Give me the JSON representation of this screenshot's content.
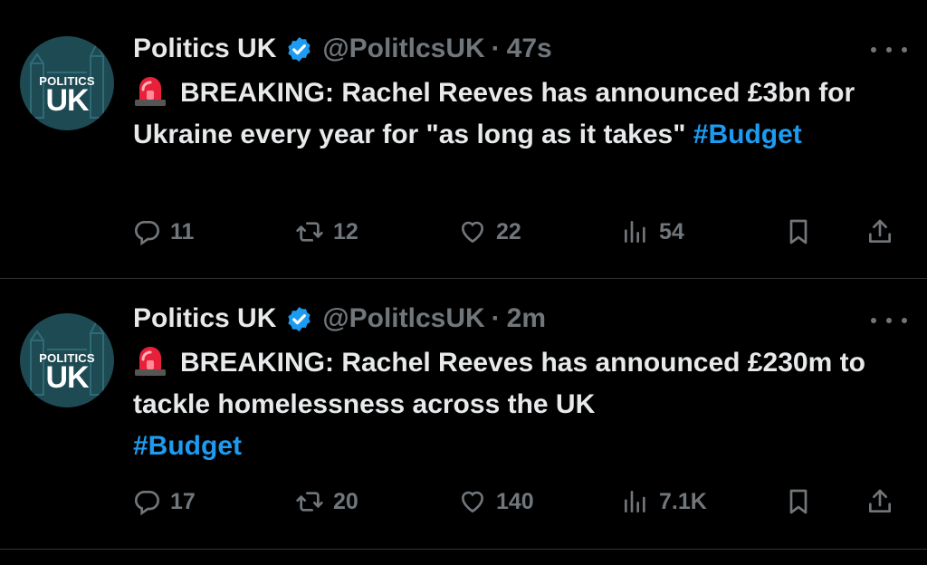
{
  "tweets": [
    {
      "author_name": "Politics UK",
      "handle": "@PolitlcsUK",
      "separator": "·",
      "time": "47s",
      "avatar": {
        "line1": "POLITICS",
        "line2": "UK",
        "bg": "#1e4a53"
      },
      "text": "BREAKING: Rachel Reeves has announced £3bn for Ukraine every year for \"as long as it takes\"",
      "hashtag": "#Budget",
      "replies": "11",
      "reposts": "12",
      "likes": "22",
      "views": "54"
    },
    {
      "author_name": "Politics UK",
      "handle": "@PolitlcsUK",
      "separator": "·",
      "time": "2m",
      "avatar": {
        "line1": "POLITICS",
        "line2": "UK",
        "bg": "#1e4a53"
      },
      "text": "BREAKING: Rachel Reeves has announced £230m to tackle homelessness across the UK",
      "hashtag": "#Budget",
      "replies": "17",
      "reposts": "20",
      "likes": "140",
      "views": "7.1K"
    }
  ],
  "colors": {
    "background": "#000000",
    "text": "#e7e9ea",
    "muted": "#71767b",
    "accent": "#1d9bf0",
    "divider": "#2f3336"
  },
  "icons": [
    "verified-badge-icon",
    "siren-emoji-icon",
    "more-icon",
    "reply-icon",
    "retweet-icon",
    "like-icon",
    "views-icon",
    "bookmark-icon",
    "share-icon"
  ]
}
